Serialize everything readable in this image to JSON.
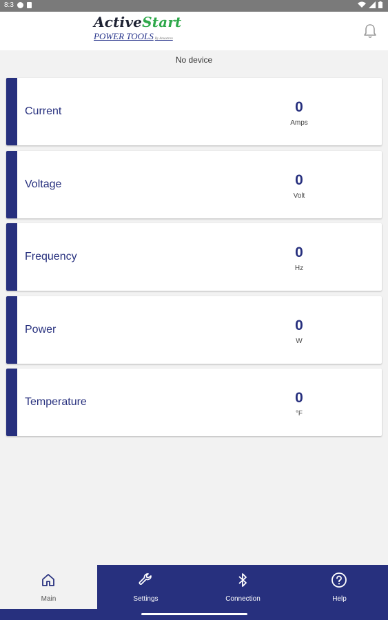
{
  "status_bar": {
    "time": "8:3"
  },
  "app": {
    "brand_part1": "Active",
    "brand_part2": "Start",
    "brand_sub": "POWER TOOLS",
    "brand_tiny": "By Amaxtron"
  },
  "device_status": "No device",
  "metrics": [
    {
      "label": "Current",
      "value": "0",
      "unit": "Amps"
    },
    {
      "label": "Voltage",
      "value": "0",
      "unit": "Volt"
    },
    {
      "label": "Frequency",
      "value": "0",
      "unit": "Hz"
    },
    {
      "label": "Power",
      "value": "0",
      "unit": "W"
    },
    {
      "label": "Temperature",
      "value": "0",
      "unit": "°F"
    }
  ],
  "nav": [
    {
      "label": "Main",
      "icon": "home-icon",
      "active": true
    },
    {
      "label": "Settings",
      "icon": "wrench-icon",
      "active": false
    },
    {
      "label": "Connection",
      "icon": "bluetooth-icon",
      "active": false
    },
    {
      "label": "Help",
      "icon": "help-icon",
      "active": false
    }
  ],
  "colors": {
    "primary": "#27307e",
    "accent": "#2ea84a",
    "background": "#f2f2f2"
  }
}
